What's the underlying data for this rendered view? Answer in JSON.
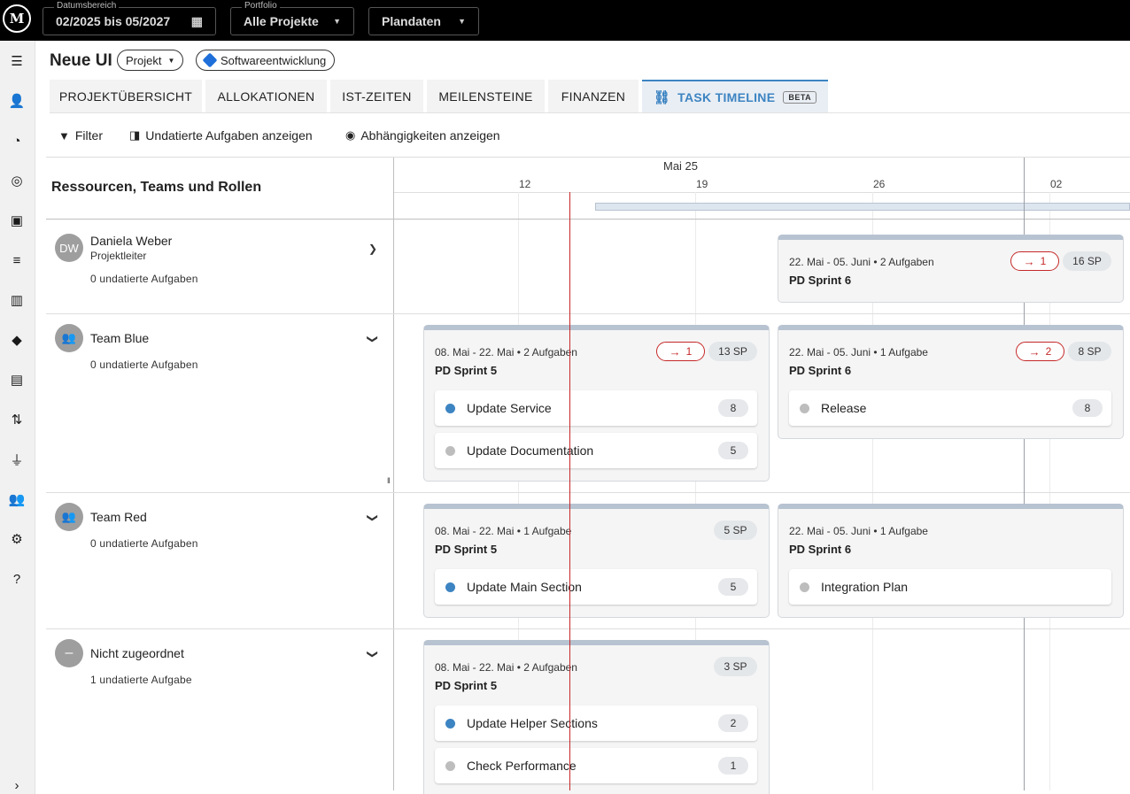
{
  "topbar": {
    "logo_text": "M",
    "date_range": {
      "label": "Datumsbereich",
      "value": "02/2025 bis 05/2027"
    },
    "portfolio": {
      "label": "Portfolio",
      "value": "Alle Projekte"
    },
    "plan": {
      "value": "Plandaten"
    }
  },
  "sidebar": {
    "icons": [
      "menu-icon",
      "user-list-icon",
      "donut-chart-icon",
      "target-icon",
      "badge-icon",
      "list-icon",
      "columns-icon",
      "directions-icon",
      "document-icon",
      "swap-icon",
      "plug-icon",
      "people-icon",
      "gear-icon",
      "help-icon",
      "expand-icon"
    ]
  },
  "header": {
    "title": "Neue UI",
    "chip_project": "Projekt",
    "chip_jira": "Softwareentwicklung"
  },
  "tabs": [
    {
      "label": "PROJEKTÜBERSICHT"
    },
    {
      "label": "ALLOKATIONEN"
    },
    {
      "label": "IST-ZEITEN"
    },
    {
      "label": "MEILENSTEINE"
    },
    {
      "label": "FINANZEN"
    },
    {
      "label": "TASK TIMELINE",
      "badge": "BETA",
      "active": true
    }
  ],
  "toolbar": {
    "filter": "Filter",
    "undated": "Undatierte Aufgaben anzeigen",
    "dependencies": "Abhängigkeiten anzeigen"
  },
  "timeline": {
    "resources_title": "Ressourcen, Teams und Rollen",
    "month": "Mai 25",
    "weeks": [
      "12",
      "19",
      "26",
      "02"
    ]
  },
  "colors": {
    "accent": "#3d84c2",
    "today": "#c62828",
    "dot_active": "#3d84c2",
    "dot_idle": "#bdbdbd"
  },
  "resources": [
    {
      "initials": "DW",
      "name": "Daniela Weber",
      "role": "Projektleiter",
      "undated": "0 undatierte Aufgaben",
      "cards": [
        {
          "meta": "22. Mai - 05. Juni • 2 Aufgaben",
          "name": "PD Sprint 6",
          "dep": "1",
          "sp": "16 SP",
          "tasks": []
        }
      ]
    },
    {
      "initials": "",
      "name": "Team Blue",
      "undated": "0 undatierte Aufgaben",
      "cards": [
        {
          "meta": "08. Mai - 22. Mai • 2 Aufgaben",
          "name": "PD Sprint 5",
          "dep": "1",
          "sp": "13 SP",
          "tasks": [
            {
              "name": "Update Service",
              "sp": "8",
              "active": true
            },
            {
              "name": "Update Documentation",
              "sp": "5",
              "active": false
            }
          ]
        },
        {
          "meta": "22. Mai - 05. Juni • 1 Aufgabe",
          "name": "PD Sprint 6",
          "dep": "2",
          "sp": "8 SP",
          "tasks": [
            {
              "name": "Release",
              "sp": "8",
              "active": false
            }
          ]
        }
      ]
    },
    {
      "initials": "",
      "name": "Team Red",
      "undated": "0 undatierte Aufgaben",
      "cards": [
        {
          "meta": "08. Mai - 22. Mai • 1 Aufgabe",
          "name": "PD Sprint 5",
          "sp": "5 SP",
          "tasks": [
            {
              "name": "Update Main Section",
              "sp": "5",
              "active": true
            }
          ]
        },
        {
          "meta": "22. Mai - 05. Juni • 1 Aufgabe",
          "name": "PD Sprint 6",
          "tasks": [
            {
              "name": "Integration Plan",
              "active": false
            }
          ]
        }
      ]
    },
    {
      "initials": "–",
      "name": "Nicht zugeordnet",
      "undated": "1 undatierte Aufgabe",
      "cards": [
        {
          "meta": "08. Mai - 22. Mai • 2 Aufgaben",
          "name": "PD Sprint 5",
          "sp": "3 SP",
          "tasks": [
            {
              "name": "Update Helper Sections",
              "sp": "2",
              "active": true
            },
            {
              "name": "Check Performance",
              "sp": "1",
              "active": false
            }
          ]
        }
      ]
    }
  ]
}
